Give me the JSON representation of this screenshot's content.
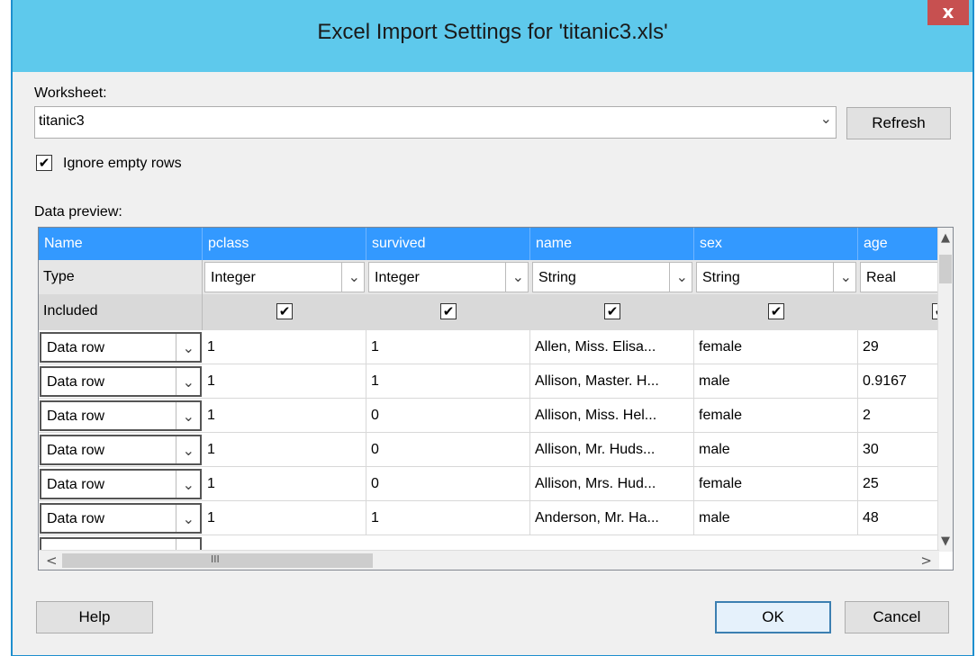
{
  "window": {
    "title": "Excel Import Settings for 'titanic3.xls'",
    "close_label": "x"
  },
  "worksheet": {
    "label": "Worksheet:",
    "value": "titanic3",
    "refresh_label": "Refresh"
  },
  "options": {
    "ignore_empty_label": "Ignore empty rows",
    "ignore_empty_checked": true
  },
  "preview": {
    "label": "Data preview:",
    "header_label": "Name",
    "type_label": "Type",
    "included_label": "Included",
    "columns": [
      {
        "name": "pclass",
        "type": "Integer"
      },
      {
        "name": "survived",
        "type": "Integer"
      },
      {
        "name": "name",
        "type": "String"
      },
      {
        "name": "sex",
        "type": "String"
      },
      {
        "name": "age",
        "type": "Real"
      }
    ],
    "rows": [
      {
        "kind": "Data row",
        "cells": [
          "1",
          "1",
          "Allen, Miss. Elisa...",
          "female",
          "29"
        ]
      },
      {
        "kind": "Data row",
        "cells": [
          "1",
          "1",
          "Allison, Master. H...",
          "male",
          "0.9167"
        ]
      },
      {
        "kind": "Data row",
        "cells": [
          "1",
          "0",
          "Allison, Miss. Hel...",
          "female",
          "2"
        ]
      },
      {
        "kind": "Data row",
        "cells": [
          "1",
          "0",
          "Allison, Mr. Huds...",
          "male",
          "30"
        ]
      },
      {
        "kind": "Data row",
        "cells": [
          "1",
          "0",
          "Allison, Mrs. Hud...",
          "female",
          "25"
        ]
      },
      {
        "kind": "Data row",
        "cells": [
          "1",
          "1",
          "Anderson, Mr. Ha...",
          "male",
          "48"
        ]
      }
    ]
  },
  "buttons": {
    "help": "Help",
    "ok": "OK",
    "cancel": "Cancel"
  },
  "glyphs": {
    "check": "✔",
    "chevron": "⌄",
    "scroll_up": "▲",
    "scroll_down": "▼",
    "scroll_left": "<",
    "scroll_right": ">",
    "grip": "III"
  }
}
